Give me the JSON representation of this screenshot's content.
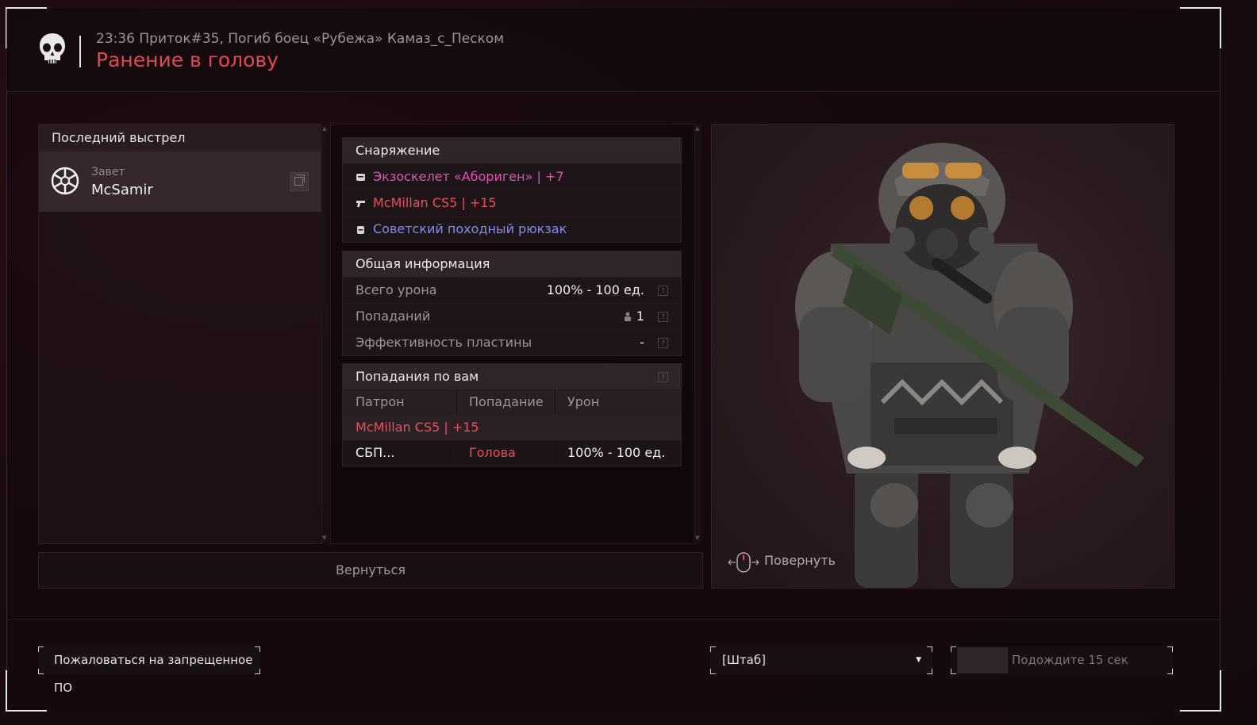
{
  "header": {
    "subtitle": "23:36 Приток#35, Погиб боец «Рубежа» Камаз_с_Песком",
    "title": "Ранение в голову"
  },
  "last_shot": {
    "heading": "Последний выстрел",
    "faction": "Завет",
    "player": "McSamir"
  },
  "equipment": {
    "heading": "Снаряжение",
    "items": [
      {
        "label": "Экзоскелет «Абориген» | +7",
        "icon": "armor-icon",
        "color": "#e052b4"
      },
      {
        "label": "McMillan CS5 | +15",
        "icon": "rifle-icon",
        "color": "#e8505a"
      },
      {
        "label": "Советский походный рюкзак",
        "icon": "backpack-icon",
        "color": "#8a86f0"
      }
    ]
  },
  "general": {
    "heading": "Общая информация",
    "rows": [
      {
        "label": "Всего урона",
        "value": "100% - 100 ед."
      },
      {
        "label": "Попаданий",
        "value": "1"
      },
      {
        "label": "Эффективность пластины",
        "value": "-"
      }
    ]
  },
  "hits": {
    "heading": "Попадания по вам",
    "columns": [
      "Патрон",
      "Попадание",
      "Урон"
    ],
    "weapon": "McMillan CS5 | +15",
    "row": {
      "ammo": "СБП...",
      "hit": "Голова",
      "damage": "100% - 100 ед."
    }
  },
  "buttons": {
    "back": "Вернуться",
    "rotate": "Повернуть",
    "report": "Пожаловаться на запрещенное ПО",
    "server": "[Штаб]",
    "wait": "Подождите 15 сек"
  },
  "icons": {
    "header": "skull-icon",
    "faction": "faction-emblem-icon",
    "copy": "copy-icon",
    "help": "question-mark-icon",
    "hit": "person-icon",
    "rotate": "mouse-rotate-icon",
    "dropdown": "chevron-down-icon"
  },
  "colors": {
    "accent_red": "#e24a52",
    "rare_pink": "#e052b4",
    "weapon_red": "#e8505a",
    "uncommon_blue": "#8a86f0"
  }
}
